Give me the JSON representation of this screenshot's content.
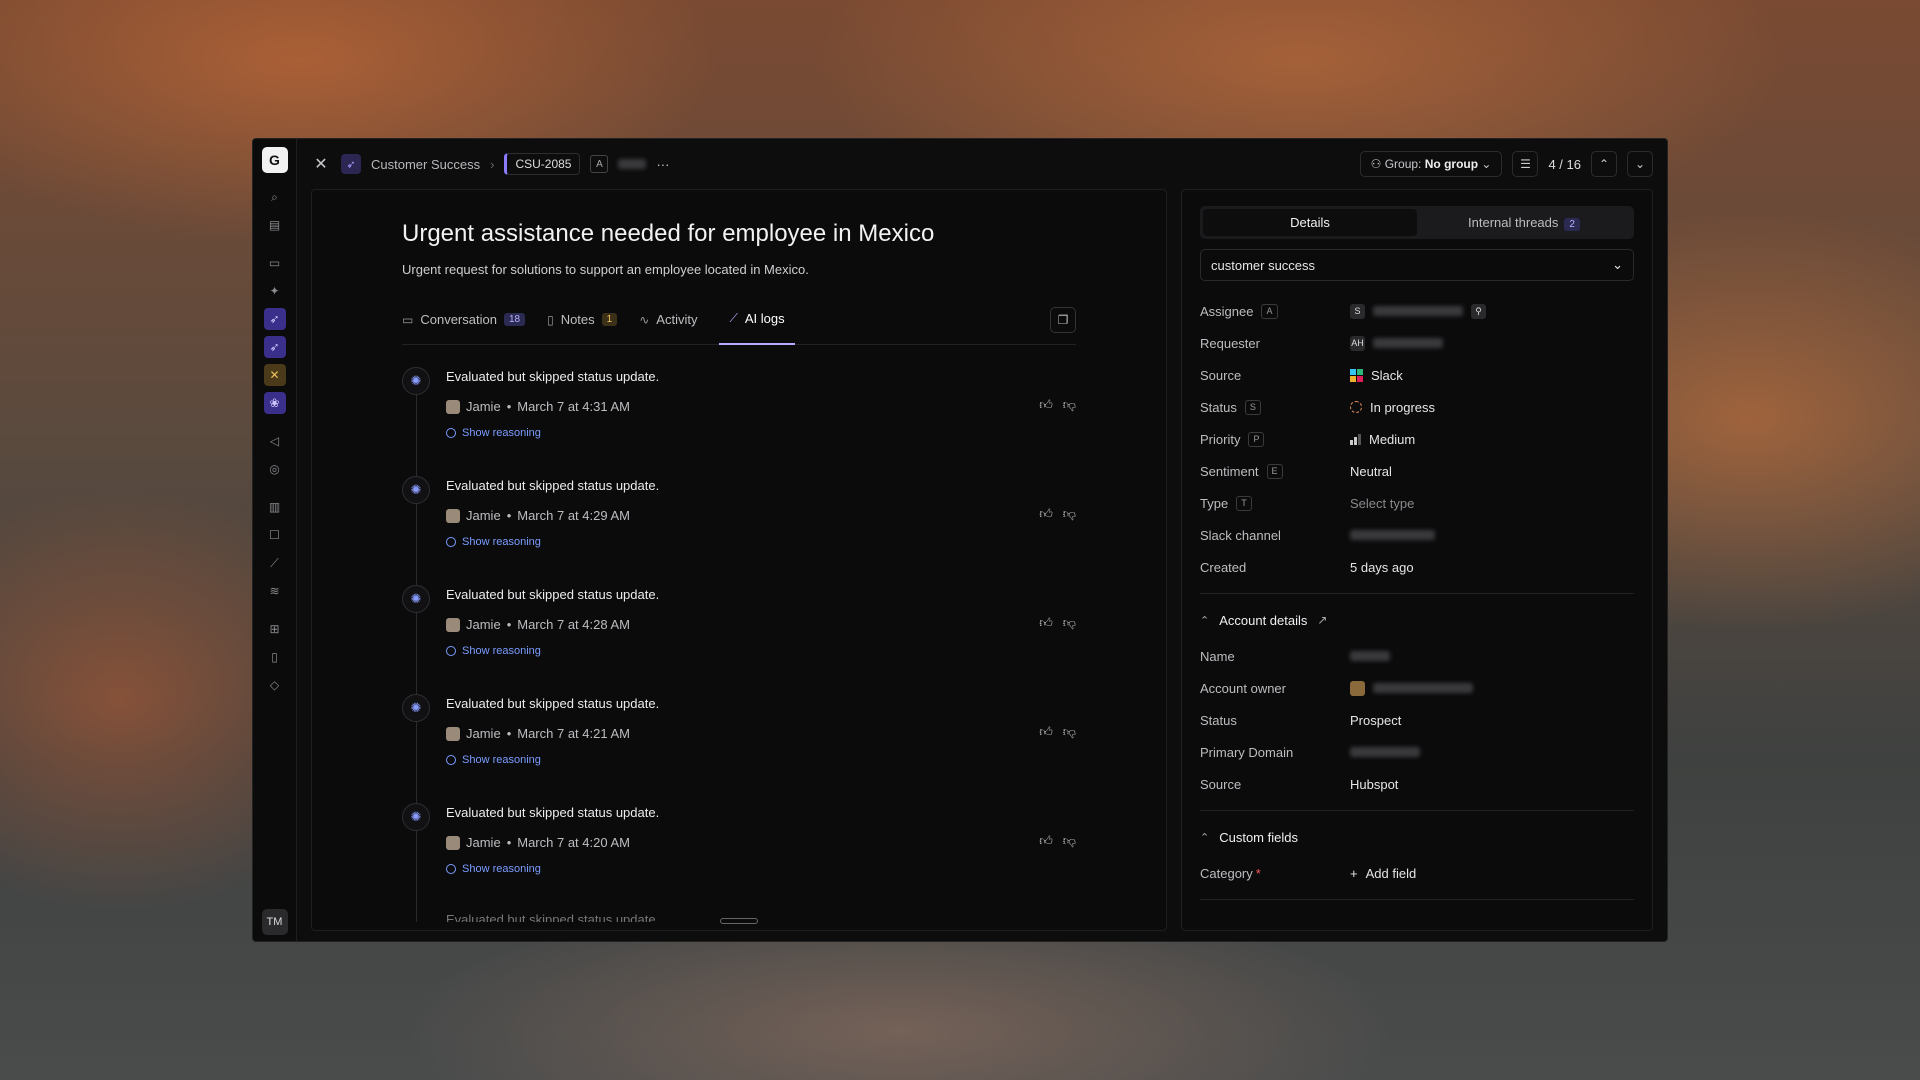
{
  "rail": {
    "logo": "G",
    "user_initials": "TM"
  },
  "topbar": {
    "breadcrumb_team": "Customer Success",
    "ticket_id": "CSU-2085",
    "assignee_chip": "A",
    "more": "···",
    "group_label": "Group:",
    "group_value": "No group",
    "pager": "4 / 16"
  },
  "ticket": {
    "title": "Urgent assistance needed for employee in Mexico",
    "summary": "Urgent request for solutions to support an employee located in Mexico."
  },
  "tabs": [
    {
      "label": "Conversation",
      "count": "18"
    },
    {
      "label": "Notes",
      "count": "1"
    },
    {
      "label": "Activity",
      "count": ""
    },
    {
      "label": "AI logs",
      "count": ""
    }
  ],
  "logs": [
    {
      "title": "Evaluated but skipped status update.",
      "user": "Jamie",
      "time": "March 7 at 4:31 AM",
      "reason": "Show reasoning"
    },
    {
      "title": "Evaluated but skipped status update.",
      "user": "Jamie",
      "time": "March 7 at 4:29 AM",
      "reason": "Show reasoning"
    },
    {
      "title": "Evaluated but skipped status update.",
      "user": "Jamie",
      "time": "March 7 at 4:28 AM",
      "reason": "Show reasoning"
    },
    {
      "title": "Evaluated but skipped status update.",
      "user": "Jamie",
      "time": "March 7 at 4:21 AM",
      "reason": "Show reasoning"
    },
    {
      "title": "Evaluated but skipped status update.",
      "user": "Jamie",
      "time": "March 7 at 4:20 AM",
      "reason": "Show reasoning"
    }
  ],
  "log_cutoff": "Evaluated but skipped status update.",
  "side": {
    "tab_details": "Details",
    "tab_threads": "Internal threads",
    "threads_count": "2",
    "team": "customer success",
    "fields": {
      "assignee": {
        "label": "Assignee",
        "key": "A",
        "avatar": "S"
      },
      "requester": {
        "label": "Requester",
        "avatar": "AH"
      },
      "source": {
        "label": "Source",
        "value": "Slack"
      },
      "status": {
        "label": "Status",
        "key": "S",
        "value": "In progress"
      },
      "priority": {
        "label": "Priority",
        "key": "P",
        "value": "Medium"
      },
      "sentiment": {
        "label": "Sentiment",
        "key": "E",
        "value": "Neutral"
      },
      "type": {
        "label": "Type",
        "key": "T",
        "value": "Select type"
      },
      "slack_channel": {
        "label": "Slack channel"
      },
      "created": {
        "label": "Created",
        "value": "5 days ago"
      }
    },
    "account": {
      "heading": "Account details",
      "name_label": "Name",
      "owner_label": "Account owner",
      "status_label": "Status",
      "status_value": "Prospect",
      "domain_label": "Primary Domain",
      "source_label": "Source",
      "source_value": "Hubspot"
    },
    "custom": {
      "heading": "Custom fields",
      "category_label": "Category",
      "required_mark": "*",
      "add_field": "Add field"
    }
  }
}
